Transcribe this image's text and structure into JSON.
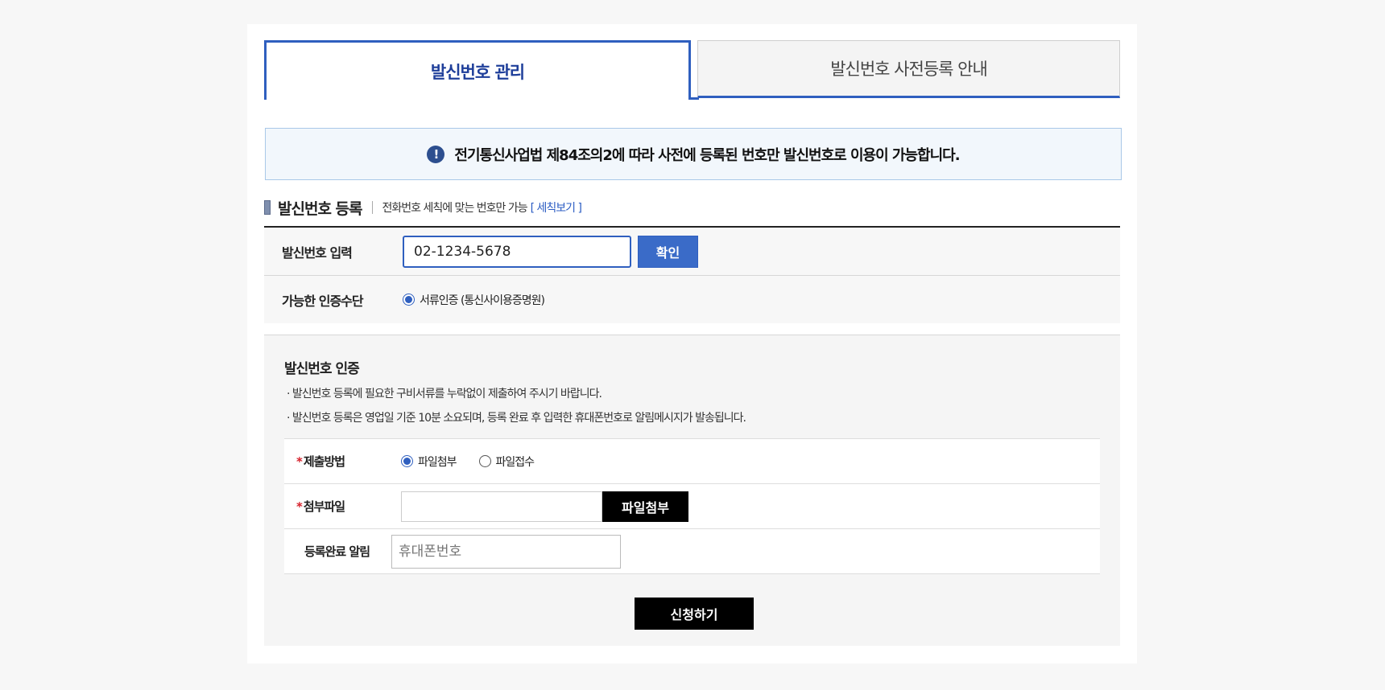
{
  "tabs": {
    "active_label": "발신번호 관리",
    "inactive_label": "발신번호 사전등록 안내"
  },
  "notice": {
    "icon": "!",
    "text": "전기통신사업법 제84조의2에 따라 사전에 등록된 번호만 발신번호로 이용이 가능합니다."
  },
  "register_section": {
    "title": "발신번호 등록",
    "description": "전화번호 세칙에 맞는 번호만 가능",
    "link_label": "[ 세칙보기 ]"
  },
  "form": {
    "phone_label": "발신번호 입력",
    "phone_value": "02-1234-5678",
    "confirm_label": "확인",
    "auth_method_label": "가능한 인증수단",
    "auth_method_option": "서류인증 (통신사이용증명원)",
    "auth_method_selected": true
  },
  "auth_section": {
    "title": "발신번호 인증",
    "note1": "·  발신번호 등록에 필요한 구비서류를 누락없이 제출하여 주시기 바랍니다.",
    "note2": "·  발신번호 등록은 영업일 기준 10분 소요되며, 등록 완료 후 입력한 휴대폰번호로 알림메시지가 발송됩니다.",
    "required_mark": "*",
    "submit_method_label": "제출방법",
    "submit_method_options": [
      "파일첨부",
      "파일접수"
    ],
    "submit_method_selected": "파일첨부",
    "attach_label": "첨부파일",
    "attach_button": "파일첨부",
    "notify_label": "등록완료 알림",
    "notify_placeholder": "휴대폰번호",
    "submit_button": "신청하기"
  },
  "colors": {
    "accent": "#2f5fbf",
    "notice_bg": "#f2f7fc",
    "required": "#d6202a"
  }
}
